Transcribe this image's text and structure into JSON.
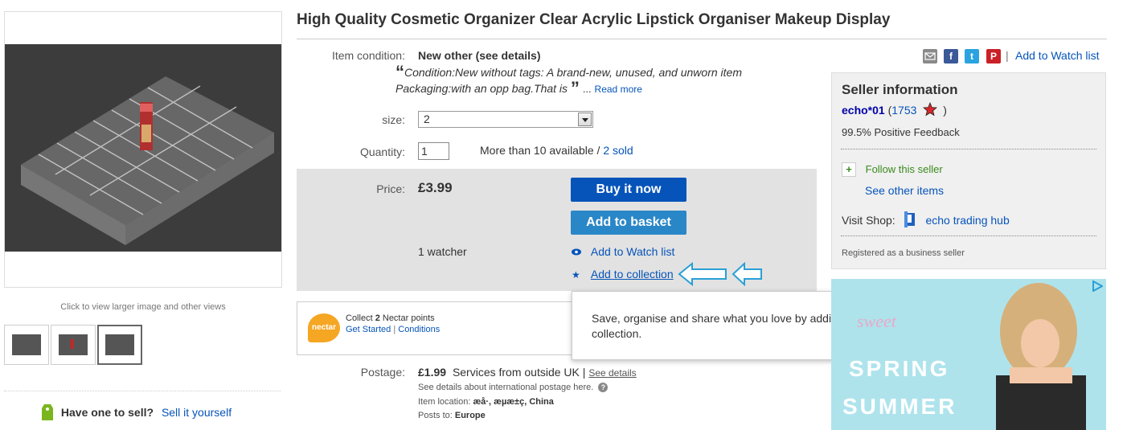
{
  "listing": {
    "title": "High Quality Cosmetic Organizer Clear Acrylic Lipstick Organiser Makeup Display"
  },
  "gallery": {
    "click_hint": "Click to view larger image and other views"
  },
  "sell": {
    "prompt": "Have one to sell?",
    "link": "Sell it yourself"
  },
  "condition": {
    "label": "Item condition:",
    "value": "New other (see details)",
    "quote_line1": "Condition:New without tags: A brand-new, unused, and unworn item",
    "quote_line2": "Packaging:with an opp bag.That is",
    "ellipsis": "...",
    "read_more": "Read more"
  },
  "size": {
    "label": "size:",
    "selected": "2"
  },
  "quantity": {
    "label": "Quantity:",
    "value": "1",
    "availability": "More than 10 available /",
    "sold": "2 sold"
  },
  "price": {
    "label": "Price:",
    "value": "£3.99",
    "watchers": "1 watcher"
  },
  "actions": {
    "buy_now": "Buy it now",
    "add_to_basket": "Add to basket",
    "add_to_watch": "Add to Watch list",
    "add_to_collection": "Add to collection"
  },
  "tooltip": {
    "text": "Save, organise and share what you love by adding this to a collection."
  },
  "nectar": {
    "logo": "nectar",
    "collect_prefix": "Collect",
    "points": "2",
    "collect_suffix": "Nectar points",
    "get_started": "Get Started",
    "separator": "|",
    "conditions": "Conditions"
  },
  "postage": {
    "label": "Postage:",
    "price": "£1.99",
    "service": "Services from outside UK |",
    "see_details": "See details",
    "intl_note": "See details about international postage here.",
    "location_label": "Item location:",
    "location_value": "æå·, æµæ±ç, China",
    "posts_to_label": "Posts to:",
    "posts_to_value": "Europe"
  },
  "share": {
    "separator": "|",
    "watch_link": "Add to Watch list"
  },
  "seller": {
    "heading": "Seller information",
    "name": "echo*01",
    "score_open": "(",
    "score": "1753",
    "score_close": ")",
    "feedback": "99.5% Positive Feedback",
    "follow": "Follow this seller",
    "see_other": "See other items",
    "visit_shop_label": "Visit Shop:",
    "shop_name": "echo trading hub",
    "registered": "Registered as a business seller"
  },
  "ad": {
    "line1": "SPRING",
    "line2": "SUMMER"
  },
  "colors": {
    "link": "#0654ba",
    "buy_button": "#0654ba",
    "basket_button": "#2a87c7",
    "price_panel": "#e2e2e2",
    "seller_panel": "#f0f0f0",
    "follow_green": "#3a8a1e"
  }
}
